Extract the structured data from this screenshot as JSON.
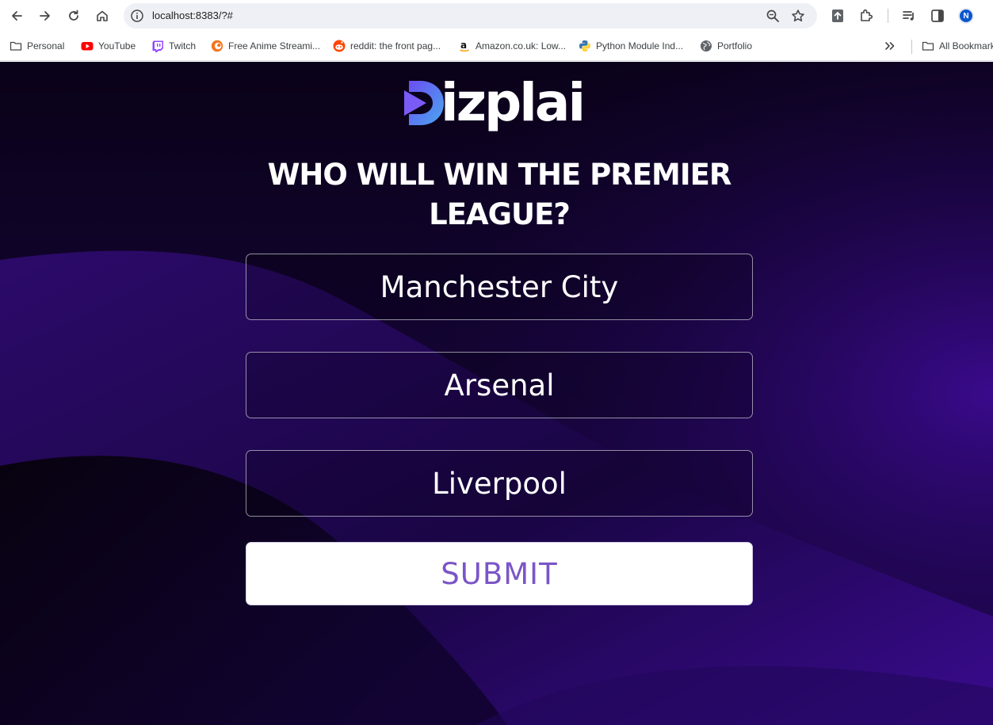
{
  "browser": {
    "url": "localhost:8383/?#",
    "profile_initial": "N",
    "bookmarks": [
      {
        "label": "Personal",
        "icon": "folder-icon"
      },
      {
        "label": "YouTube",
        "icon": "youtube-icon"
      },
      {
        "label": "Twitch",
        "icon": "twitch-icon"
      },
      {
        "label": "Free Anime Streami...",
        "icon": "crunchyroll-icon"
      },
      {
        "label": "reddit: the front pag...",
        "icon": "reddit-icon"
      },
      {
        "label": "Amazon.co.uk: Low...",
        "icon": "amazon-icon"
      },
      {
        "label": "Python Module Ind...",
        "icon": "python-icon"
      },
      {
        "label": "Portfolio",
        "icon": "globe-icon"
      }
    ],
    "all_bookmarks_label": "All Bookmarks",
    "colors": {
      "youtube": "#ff0000",
      "twitch": "#9146ff",
      "crunchyroll": "#f47521",
      "reddit": "#ff4500",
      "avatar": "#0b57d0"
    }
  },
  "app": {
    "logo_text": "izplai",
    "question": "WHO WILL WIN THE PREMIER LEAGUE?",
    "options": [
      {
        "label": "Manchester City"
      },
      {
        "label": "Arsenal"
      },
      {
        "label": "Liverpool"
      }
    ],
    "submit_label": "SUBMIT",
    "colors": {
      "background": "#0b0220",
      "accent_purple": "#3a0a8c",
      "submit_text": "#7b55c7",
      "logo_blue": "#4aa8f0",
      "logo_violet": "#6b4df2"
    }
  }
}
